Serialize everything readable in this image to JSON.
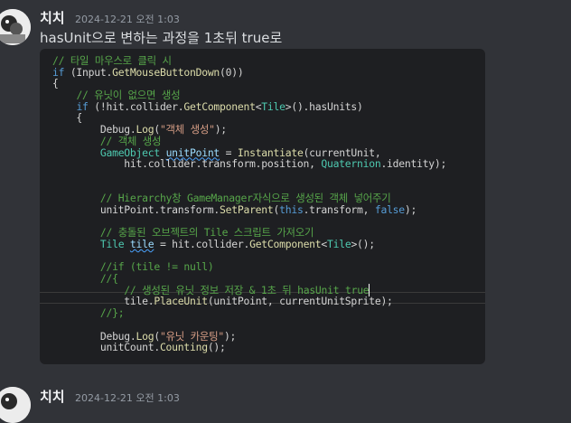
{
  "message1": {
    "username": "치치",
    "timestamp": "2024-12-21 오전 1:03",
    "text": "hasUnit으로 변하는 과정을 1초뒤 true로"
  },
  "message2": {
    "username": "치치",
    "timestamp": "2024-12-21 오전 1:03"
  },
  "colors": {
    "background": "#313338",
    "codeblock": "#1e1f22",
    "keyword": "#569cd6",
    "type": "#4ec9b0",
    "comment": "#57a64a",
    "string": "#d69d85",
    "method": "#dcdcaa"
  },
  "code_lines": [
    [
      [
        "cm",
        "// 타일 마우스로 클릭 시"
      ]
    ],
    [
      [
        "kw",
        "if"
      ],
      [
        "pl",
        " (Input."
      ],
      [
        "fn",
        "GetMouseButtonDown"
      ],
      [
        "pl",
        "(0))"
      ]
    ],
    [
      [
        "pl",
        "{"
      ]
    ],
    [
      [
        "pl",
        "    "
      ],
      [
        "cm",
        "// 유닛이 없으면 생성"
      ]
    ],
    [
      [
        "pl",
        "    "
      ],
      [
        "kw",
        "if"
      ],
      [
        "pl",
        " (!hit.collider."
      ],
      [
        "fn",
        "GetComponent"
      ],
      [
        "pl",
        "<"
      ],
      [
        "tp",
        "Tile"
      ],
      [
        "pl",
        ">().hasUnits)"
      ]
    ],
    [
      [
        "pl",
        "    {"
      ]
    ],
    [
      [
        "pl",
        "        Debug."
      ],
      [
        "fn",
        "Log"
      ],
      [
        "pl",
        "("
      ],
      [
        "st",
        "\"객체 생성\""
      ],
      [
        "pl",
        ");"
      ]
    ],
    [
      [
        "pl",
        "        "
      ],
      [
        "cm",
        "// 객체 생성"
      ]
    ],
    [
      [
        "pl",
        "        "
      ],
      [
        "tp",
        "GameObject"
      ],
      [
        "pl",
        " "
      ],
      [
        "vr",
        "unitPoint"
      ],
      [
        "pl",
        " = "
      ],
      [
        "fn",
        "Instantiate"
      ],
      [
        "pl",
        "(currentUnit,"
      ]
    ],
    [
      [
        "pl",
        "            hit.collider.transform.position, "
      ],
      [
        "tp",
        "Quaternion"
      ],
      [
        "pl",
        ".identity);"
      ]
    ],
    [
      [
        "pl",
        ""
      ]
    ],
    [
      [
        "pl",
        ""
      ]
    ],
    [
      [
        "pl",
        "        "
      ],
      [
        "cm",
        "// Hierarchy창 GameManager자식으로 생성된 객체 넣어주기"
      ]
    ],
    [
      [
        "pl",
        "        unitPoint.transform."
      ],
      [
        "fn",
        "SetParent"
      ],
      [
        "pl",
        "("
      ],
      [
        "kw",
        "this"
      ],
      [
        "pl",
        ".transform, "
      ],
      [
        "kw",
        "false"
      ],
      [
        "pl",
        ");"
      ]
    ],
    [
      [
        "pl",
        ""
      ]
    ],
    [
      [
        "pl",
        "        "
      ],
      [
        "cm",
        "// 충돌된 오브젝트의 Tile 스크립트 가져오기"
      ]
    ],
    [
      [
        "pl",
        "        "
      ],
      [
        "tp",
        "Tile"
      ],
      [
        "pl",
        " "
      ],
      [
        "vr",
        "tile"
      ],
      [
        "pl",
        " = hit.collider."
      ],
      [
        "fn",
        "GetComponent"
      ],
      [
        "pl",
        "<"
      ],
      [
        "tp",
        "Tile"
      ],
      [
        "pl",
        ">();"
      ]
    ],
    [
      [
        "pl",
        ""
      ]
    ],
    [
      [
        "pl",
        "        "
      ],
      [
        "cm",
        "//if (tile != null)"
      ]
    ],
    [
      [
        "pl",
        "        "
      ],
      [
        "cm",
        "//{"
      ]
    ],
    [
      [
        "pl",
        "            "
      ],
      [
        "cm",
        "// 생성된 유닛 정보 저장 & 1초 뒤 hasUnit true"
      ]
    ],
    [
      [
        "pl",
        "            tile."
      ],
      [
        "fn",
        "PlaceUnit"
      ],
      [
        "pl",
        "(unitPoint, currentUnitSprite);"
      ]
    ],
    [
      [
        "pl",
        "        "
      ],
      [
        "cm",
        "//};"
      ]
    ],
    [
      [
        "pl",
        ""
      ]
    ],
    [
      [
        "pl",
        "        Debug."
      ],
      [
        "fn",
        "Log"
      ],
      [
        "pl",
        "("
      ],
      [
        "st",
        "\"유닛 카운팅\""
      ],
      [
        "pl",
        ");"
      ]
    ],
    [
      [
        "pl",
        "        unitCount."
      ],
      [
        "fn",
        "Counting"
      ],
      [
        "pl",
        "();"
      ]
    ]
  ]
}
